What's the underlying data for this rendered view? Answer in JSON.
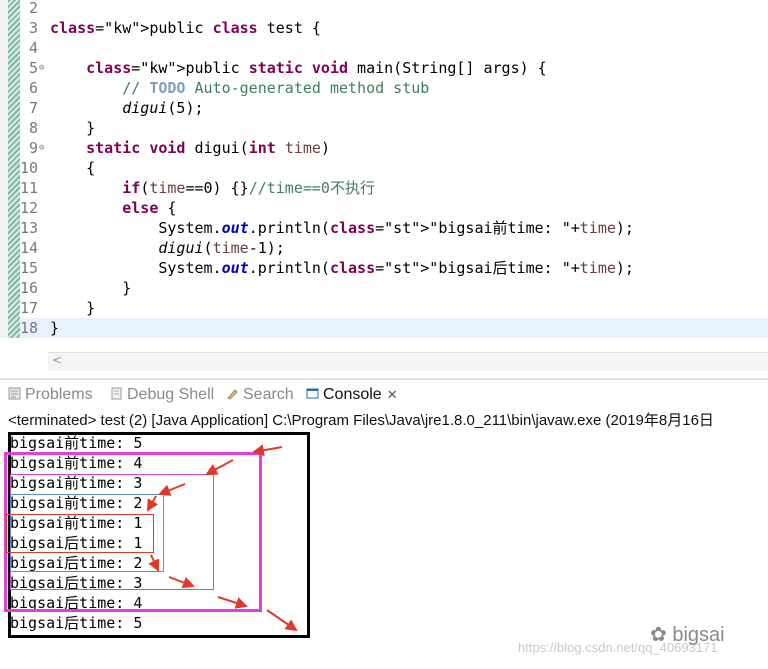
{
  "editor": {
    "lines": [
      {
        "num": "2",
        "code": ""
      },
      {
        "num": "3",
        "code": "public class test {"
      },
      {
        "num": "4",
        "code": ""
      },
      {
        "num": "5",
        "code": "    public static void main(String[] args) {"
      },
      {
        "num": "6",
        "code": "        // TODO Auto-generated method stub"
      },
      {
        "num": "7",
        "code": "        digui(5);"
      },
      {
        "num": "8",
        "code": "    }"
      },
      {
        "num": "9",
        "code": "    static void digui(int time)"
      },
      {
        "num": "10",
        "code": "    {"
      },
      {
        "num": "11",
        "code": "        if(time==0) {}//time==0不执行"
      },
      {
        "num": "12",
        "code": "        else {"
      },
      {
        "num": "13",
        "code": "            System.out.println(\"bigsai前time: \"+time);"
      },
      {
        "num": "14",
        "code": "            digui(time-1);"
      },
      {
        "num": "15",
        "code": "            System.out.println(\"bigsai后time: \"+time);"
      },
      {
        "num": "16",
        "code": "        }"
      },
      {
        "num": "17",
        "code": "    }"
      },
      {
        "num": "18",
        "code": "}"
      }
    ]
  },
  "tabs": [
    {
      "label": "Problems",
      "icon": "problems-icon",
      "active": false
    },
    {
      "label": "Debug Shell",
      "icon": "debug-shell-icon",
      "active": false
    },
    {
      "label": "Search",
      "icon": "search-icon",
      "active": false
    },
    {
      "label": "Console",
      "icon": "console-icon",
      "active": true,
      "close": "✕"
    }
  ],
  "console": {
    "status": "<terminated> test (2) [Java Application] C:\\Program Files\\Java\\jre1.8.0_211\\bin\\javaw.exe (2019年8月16日",
    "output": [
      "bigsai前time: 5",
      "bigsai前time: 4",
      "bigsai前time: 3",
      "bigsai前time: 2",
      "bigsai前time: 1",
      "bigsai后time: 1",
      "bigsai后time: 2",
      "bigsai后time: 3",
      "bigsai后time: 4",
      "bigsai后time: 5"
    ]
  },
  "watermark": {
    "url": "https://blog.csdn.net/qq_40693171",
    "brand": "bigsai"
  },
  "colors": {
    "keyword": "#7f0055",
    "comment": "#3f7f5f",
    "string": "#2a00ff",
    "annotation_red": "#e0392b",
    "annotation_magenta": "#e23ed8",
    "annotation_blue": "#5b8bd0"
  }
}
